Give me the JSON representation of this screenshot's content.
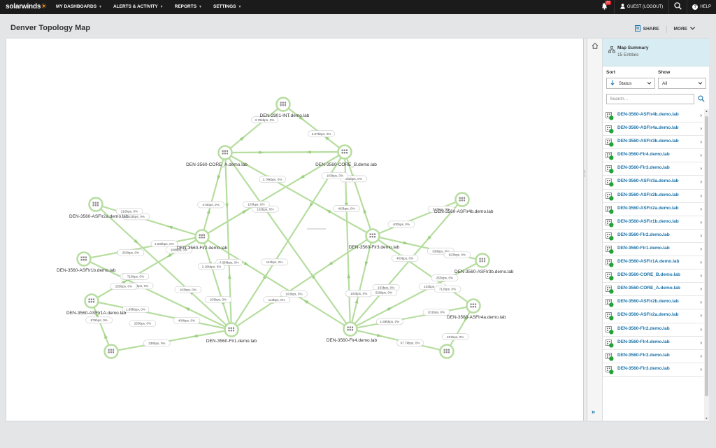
{
  "header": {
    "brand": "solarwinds",
    "nav": [
      {
        "label": "MY DASHBOARDS"
      },
      {
        "label": "ALERTS & ACTIVITY"
      },
      {
        "label": "REPORTS"
      },
      {
        "label": "SETTINGS"
      }
    ],
    "alert_count": "20",
    "user_label": "GUEST (LOGOUT)",
    "help_label": "HELP"
  },
  "page": {
    "title": "Denver Topology Map",
    "share_label": "SHARE",
    "more_label": "MORE"
  },
  "map": {
    "nodes": [
      {
        "id": "int",
        "label": "DEN-2901-INT.demo.lab"
      },
      {
        "id": "coreA",
        "label": "DEN-3560-CORE_A.demo.lab"
      },
      {
        "id": "coreB",
        "label": "DEN-3560-CORE_B.demo.lab"
      },
      {
        "id": "flr2",
        "label": "DEN-3560-Flr2.demo.lab"
      },
      {
        "id": "flr3",
        "label": "DEN-3560-Flr3.demo.lab"
      },
      {
        "id": "flr1",
        "label": "DEN-3560-Flr1.demo.lab"
      },
      {
        "id": "flr4",
        "label": "DEN-3560-Flr4.demo.lab"
      },
      {
        "id": "a2a",
        "label": "DEN-3560-ASFlr2a.demo.lab"
      },
      {
        "id": "a1b",
        "label": "DEN-3560-ASFlr1b.demo.lab"
      },
      {
        "id": "a1a",
        "label": "DEN-3560-ASFlr1A.demo.lab"
      },
      {
        "id": "a2b",
        "label": ""
      },
      {
        "id": "a4b",
        "label": "DEN-3560-ASFlr4b.demo.lab"
      },
      {
        "id": "a3b",
        "label": "DEN-3560-ASFlr3b.demo.lab"
      },
      {
        "id": "a4a",
        "label": "DEN-3560-ASFlr4a.demo.lab"
      },
      {
        "id": "a3a",
        "label": ""
      }
    ],
    "links": [
      {
        "from": "int",
        "to": "coreA",
        "label": "3.76kbps, 0%"
      },
      {
        "from": "int",
        "to": "coreB",
        "label": "3.87kbps, 0%"
      },
      {
        "from": "coreA",
        "to": "coreB",
        "label": ""
      },
      {
        "from": "coreA",
        "to": "flr2",
        "label": "473bps, 0%"
      },
      {
        "from": "coreA",
        "to": "flr3",
        "label": "1.79kbps, 0%"
      },
      {
        "from": "coreA",
        "to": "flr1",
        "label": "3.09kbps, 0%"
      },
      {
        "from": "coreA",
        "to": "flr4",
        "label": "102bps, 0%"
      },
      {
        "from": "coreB",
        "to": "flr2",
        "label": "103bps, 0%"
      },
      {
        "from": "coreB",
        "to": "flr3",
        "label": "463bps, 0%"
      },
      {
        "from": "coreB",
        "to": "flr1",
        "label": "112bps, 0%"
      },
      {
        "from": "coreB",
        "to": "flr4",
        "label": "463bps, 0%"
      },
      {
        "from": "flr2",
        "to": "a2a",
        "label": "103bps, 0%"
      },
      {
        "from": "flr2",
        "to": "a1b",
        "label": "1.83kbps, 0%"
      },
      {
        "from": "flr2",
        "to": "a1a",
        "label": "103bps, 0%"
      },
      {
        "from": "flr2",
        "to": "flr1",
        "label": "2.10kbps, 0%"
      },
      {
        "from": "flr2",
        "to": "flr4",
        "label": "103bps, 0%"
      },
      {
        "from": "flr1",
        "to": "a2a",
        "label": "103bps, 0%"
      },
      {
        "from": "flr1",
        "to": "a1b",
        "label": "440bps, 0%"
      },
      {
        "from": "flr1",
        "to": "a1a",
        "label": "400bps, 0%"
      },
      {
        "from": "flr1",
        "to": "a2b",
        "label": "338bps, 0%"
      },
      {
        "from": "flr1",
        "to": "flr3",
        "label": "113bps, 0%"
      },
      {
        "from": "a2b",
        "to": "a1a",
        "label": "879bps, 0%"
      },
      {
        "from": "flr3",
        "to": "a4b",
        "label": "400bps, 0%"
      },
      {
        "from": "flr3",
        "to": "a3b",
        "label": "338bps, 0%"
      },
      {
        "from": "flr3",
        "to": "a4a",
        "label": "403bps, 0%"
      },
      {
        "from": "flr3",
        "to": "flr4",
        "label": "103bps, 0%"
      },
      {
        "from": "flr4",
        "to": "a4b",
        "label": "103bps, 0%"
      },
      {
        "from": "flr4",
        "to": "a3b",
        "label": "103bps, 0%"
      },
      {
        "from": "flr4",
        "to": "a4a",
        "label": "1.69kbps, 0%"
      },
      {
        "from": "flr4",
        "to": "a3a",
        "label": "97.7kbps, 0%"
      },
      {
        "from": "a3a",
        "to": "a4a",
        "label": "201bps, 0%"
      }
    ],
    "extra_labels": [
      "218bps, 0%",
      "253bps, 0%",
      "716bps, 0%",
      "255bps, 0%",
      "1.85kbps, 0%",
      "253bps, 0%",
      "108bps, 0%",
      "103bps, 0%",
      "517bps, 0%",
      "823bps, 0%",
      "255bps, 0%",
      "712bps, 0%",
      "201bps, 0%",
      "529bps, 0%",
      "103bps, 0%"
    ]
  },
  "sidebar": {
    "summary_title": "Map Summary",
    "summary_count": "15 Entities",
    "sort_label": "Sort",
    "show_label": "Show",
    "sort_value": "Status",
    "show_value": "All",
    "search_placeholder": "Search...",
    "items": [
      {
        "label": "DEN-3560-ASFlr4b.demo.lab"
      },
      {
        "label": "DEN-3560-ASFlr4a.demo.lab"
      },
      {
        "label": "DEN-3560-ASFlr3b.demo.lab"
      },
      {
        "label": "DEN-3560-Flr4.demo.lab"
      },
      {
        "label": "DEN-3560-Flr3.demo.lab"
      },
      {
        "label": "DEN-3560-ASFlr3a.demo.lab"
      },
      {
        "label": "DEN-3560-ASFlr2b.demo.lab"
      },
      {
        "label": "DEN-3560-ASFlr2a.demo.lab"
      },
      {
        "label": "DEN-3560-ASFlr1b.demo.lab"
      },
      {
        "label": "DEN-3560-Flr2.demo.lab"
      },
      {
        "label": "DEN-3560-Flr1.demo.lab"
      },
      {
        "label": "DEN-3560-ASFlr1A.demo.lab"
      },
      {
        "label": "DEN-3560-CORE_B.demo.lab"
      },
      {
        "label": "DEN-3560-CORE_A.demo.lab"
      },
      {
        "label": "DEN-3560-ASFlr2b.demo.lab"
      },
      {
        "label": "DEN-3560-ASFlr2a.demo.lab"
      },
      {
        "label": "DEN-3560-Flr2.demo.lab"
      },
      {
        "label": "DEN-3560-Flr4.demo.lab"
      },
      {
        "label": "DEN-3560-Flr3.demo.lab"
      },
      {
        "label": "DEN-3560-Flr3.demo.lab"
      }
    ]
  },
  "colors": {
    "accent_orange": "#f7941d",
    "link_blue": "#1a72a8",
    "status_up": "#22a33a",
    "edge_green": "#b6dd9f",
    "topbar": "#1b1b1b"
  }
}
